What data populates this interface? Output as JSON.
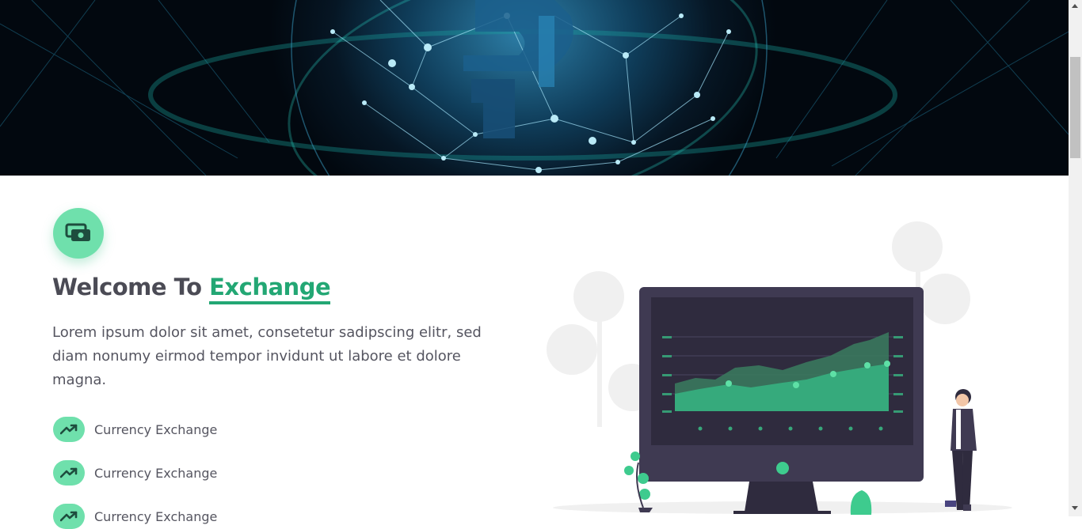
{
  "hero": {
    "alt": "network globe banner"
  },
  "about": {
    "icon": "money-icon",
    "title_prefix": "Welcome To",
    "title_accent": "Exchange",
    "description": "Lorem ipsum dolor sit amet, consetetur sadipscing elitr, sed diam nonumy eirmod tempor invidunt ut labore et dolore magna.",
    "features": [
      {
        "icon": "trending-up-icon",
        "label": "Currency Exchange"
      },
      {
        "icon": "trending-up-icon",
        "label": "Currency Exchange"
      },
      {
        "icon": "trending-up-icon",
        "label": "Currency Exchange"
      }
    ]
  },
  "colors": {
    "accent": "#23a774",
    "accent_light": "#6fe0ac",
    "heading": "#4b4b55",
    "text": "#555560",
    "monitor": "#3f3a52"
  }
}
